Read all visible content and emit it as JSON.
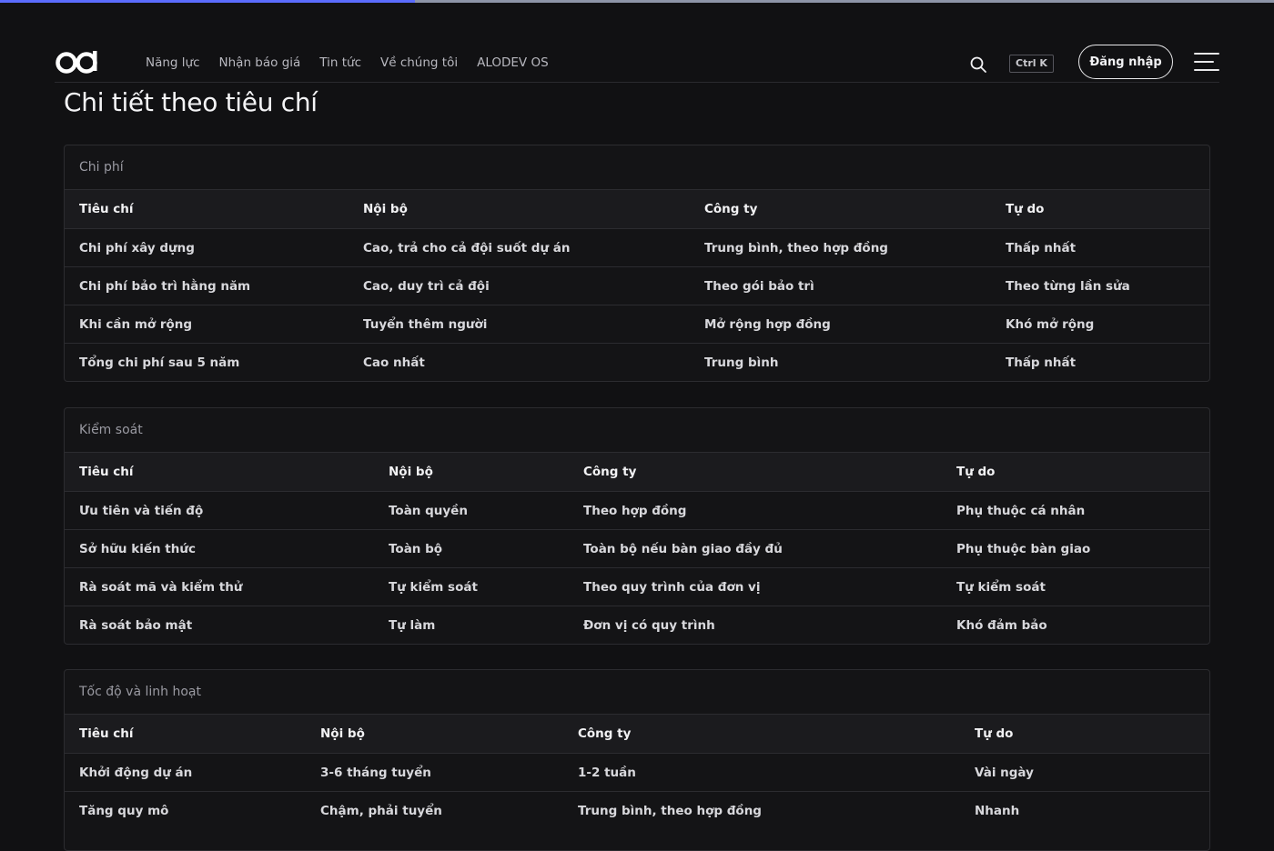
{
  "nav": {
    "items": [
      "Năng lực",
      "Nhận báo giá",
      "Tin tức",
      "Về chúng tôi",
      "ALODEV OS"
    ],
    "search_shortcut": "Ctrl K",
    "login_label": "Đăng nhập"
  },
  "page": {
    "title": "Chi tiết theo tiêu chí"
  },
  "sections": [
    {
      "title": "Chi phí",
      "headers": [
        "Tiêu chí",
        "Nội bộ",
        "Công ty",
        "Tự do"
      ],
      "rows": [
        [
          "Chi phí xây dựng",
          "Cao, trả cho cả đội suốt dự án",
          "Trung bình, theo hợp đồng",
          "Thấp nhất"
        ],
        [
          "Chi phí bảo trì hằng năm",
          "Cao, duy trì cả đội",
          "Theo gói bảo trì",
          "Theo từng lần sửa"
        ],
        [
          "Khi cần mở rộng",
          "Tuyển thêm người",
          "Mở rộng hợp đồng",
          "Khó mở rộng"
        ],
        [
          "Tổng chi phí sau 5 năm",
          "Cao nhất",
          "Trung bình",
          "Thấp nhất"
        ]
      ]
    },
    {
      "title": "Kiểm soát",
      "headers": [
        "Tiêu chí",
        "Nội bộ",
        "Công ty",
        "Tự do"
      ],
      "rows": [
        [
          "Ưu tiên và tiến độ",
          "Toàn quyền",
          "Theo hợp đồng",
          "Phụ thuộc cá nhân"
        ],
        [
          "Sở hữu kiến thức",
          "Toàn bộ",
          "Toàn bộ nếu bàn giao đầy đủ",
          "Phụ thuộc bàn giao"
        ],
        [
          "Rà soát mã và kiểm thử",
          "Tự kiểm soát",
          "Theo quy trình của đơn vị",
          "Tự kiểm soát"
        ],
        [
          "Rà soát bảo mật",
          "Tự làm",
          "Đơn vị có quy trình",
          "Khó đảm bảo"
        ]
      ]
    },
    {
      "title": "Tốc độ và linh hoạt",
      "headers": [
        "Tiêu chí",
        "Nội bộ",
        "Công ty",
        "Tự do"
      ],
      "rows": [
        [
          "Khởi động dự án",
          "3-6 tháng tuyển",
          "1-2 tuần",
          "Vài ngày"
        ],
        [
          "Tăng quy mô",
          "Chậm, phải tuyển",
          "Trung bình, theo hợp đồng",
          "Nhanh"
        ]
      ]
    }
  ]
}
